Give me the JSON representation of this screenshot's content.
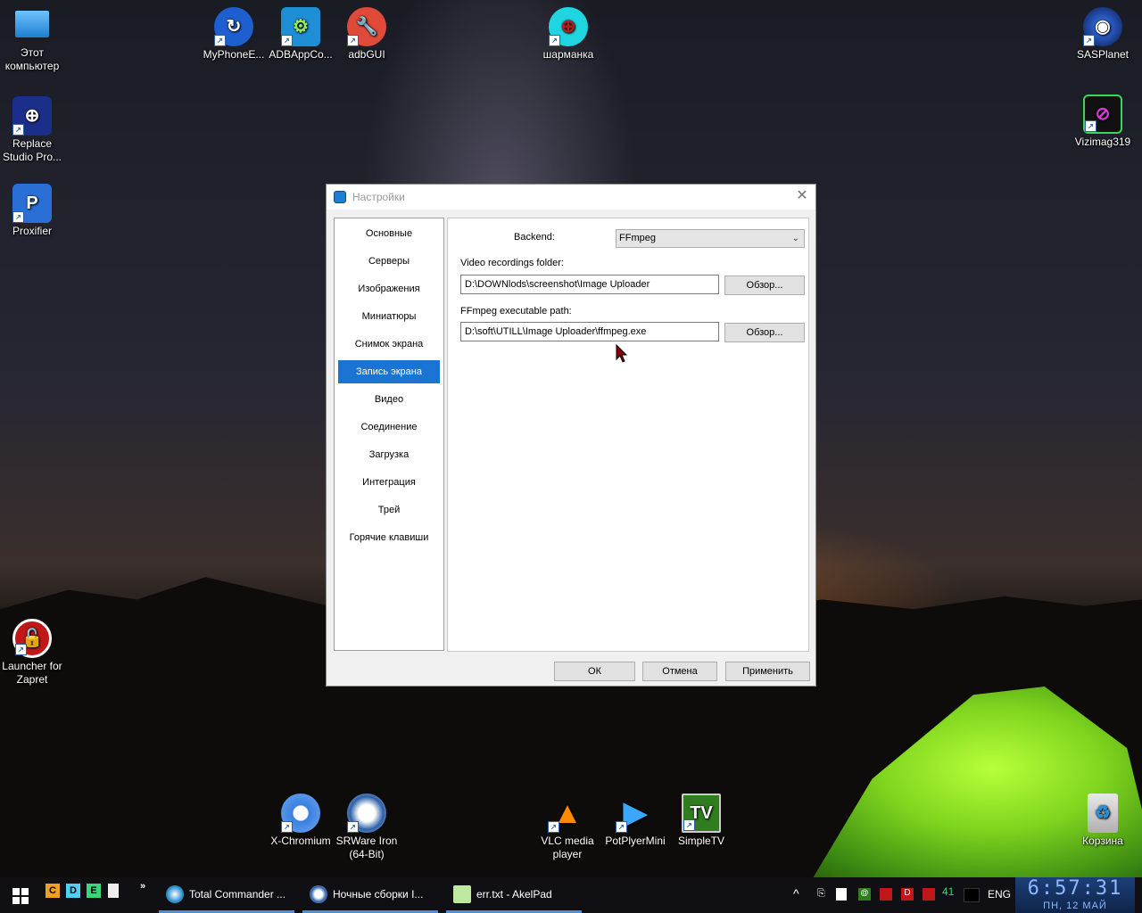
{
  "desktop": {
    "icons": [
      {
        "label": "Этот компьютер",
        "icon": "computer-icon"
      },
      {
        "label": "Replace Studio Pro...",
        "icon": "binoculars-icon"
      },
      {
        "label": "Proxifier",
        "icon": "proxifier-icon"
      },
      {
        "label": "Launcher for Zapret",
        "icon": "lock-icon"
      },
      {
        "label": "MyPhoneE...",
        "icon": "sync-icon"
      },
      {
        "label": "ADBAppCo...",
        "icon": "android-icon"
      },
      {
        "label": "adbGUI",
        "icon": "wrench-icon"
      },
      {
        "label": "шарманка",
        "icon": "globe-icon"
      },
      {
        "label": "SASPlanet",
        "icon": "planet-icon"
      },
      {
        "label": "Vizimag319",
        "icon": "magnet-icon"
      },
      {
        "label": "X-Chromium",
        "icon": "chromium-icon"
      },
      {
        "label": "SRWare Iron (64-Bit)",
        "icon": "iron-icon"
      },
      {
        "label": "VLC media player",
        "icon": "vlc-icon"
      },
      {
        "label": "PotPlyerMini",
        "icon": "play-icon"
      },
      {
        "label": "SimpleTV",
        "icon": "tv-icon"
      },
      {
        "label": "Корзина",
        "icon": "recycle-bin-icon"
      }
    ]
  },
  "dialog": {
    "title": "Настройки",
    "nav": [
      "Основные",
      "Серверы",
      "Изображения",
      "Миниатюры",
      "Снимок экрана",
      "Запись экрана",
      "Видео",
      "Соединение",
      "Загрузка",
      "Интеграция",
      "Трей",
      "Горячие клавиши"
    ],
    "active_nav": "Запись экрана",
    "backend_label": "Backend:",
    "backend_value": "FFmpeg",
    "video_folder_label": "Video recordings folder:",
    "video_folder_value": "D:\\DOWNlods\\screenshot\\Image Uploader",
    "ffmpeg_path_label": "FFmpeg executable path:",
    "ffmpeg_path_value": "D:\\soft\\UTILL\\Image Uploader\\ffmpeg.exe",
    "browse_label": "Обзор...",
    "ok_label": "ОК",
    "cancel_label": "Отмена",
    "apply_label": "Применить"
  },
  "taskbar": {
    "quicklaunch": [
      "C",
      "D",
      "E"
    ],
    "overflow": "»",
    "tasks": [
      {
        "label": "Total Commander ...",
        "icon": "total-commander-icon"
      },
      {
        "label": "Ночные сборки I...",
        "icon": "browser-icon"
      },
      {
        "label": "err.txt - AkelPad",
        "icon": "notepad-icon"
      }
    ],
    "tray_number": "41",
    "language": "ENG",
    "time": "6:57:31",
    "date": "ПН, 12 МАЙ"
  }
}
